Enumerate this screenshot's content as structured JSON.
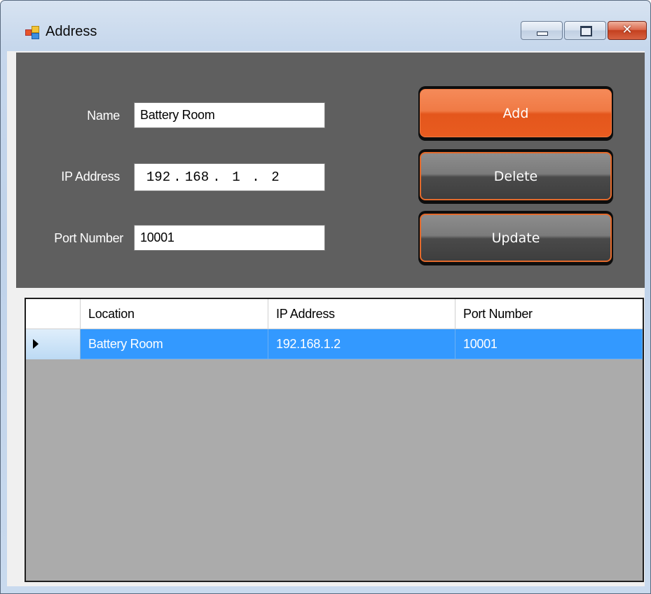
{
  "window": {
    "title": "Address",
    "icon": "app-window-icon",
    "controls": {
      "minimize_icon": "minimize-icon",
      "maximize_icon": "maximize-icon",
      "close_glyph": "✕"
    }
  },
  "form": {
    "name_label": "Name",
    "name_value": "Battery Room",
    "ip_label": "IP Address",
    "ip_segments": [
      "192",
      "168",
      "1",
      "2"
    ],
    "ip_dot": ".",
    "port_label": "Port Number",
    "port_value": "10001"
  },
  "buttons": {
    "add": "Add",
    "delete": "Delete",
    "update": "Update"
  },
  "grid": {
    "columns": [
      "Location",
      "IP Address",
      "Port Number"
    ],
    "rows": [
      {
        "location": "Battery Room",
        "ip": "192.168.1.2",
        "port": "10001",
        "selected": true
      }
    ]
  },
  "colors": {
    "panel_bg": "#5f5f5f",
    "primary_button": "#f07a45",
    "button_border_accent": "#e36a2c",
    "selection": "#3399ff",
    "grid_empty_bg": "#ababab"
  }
}
